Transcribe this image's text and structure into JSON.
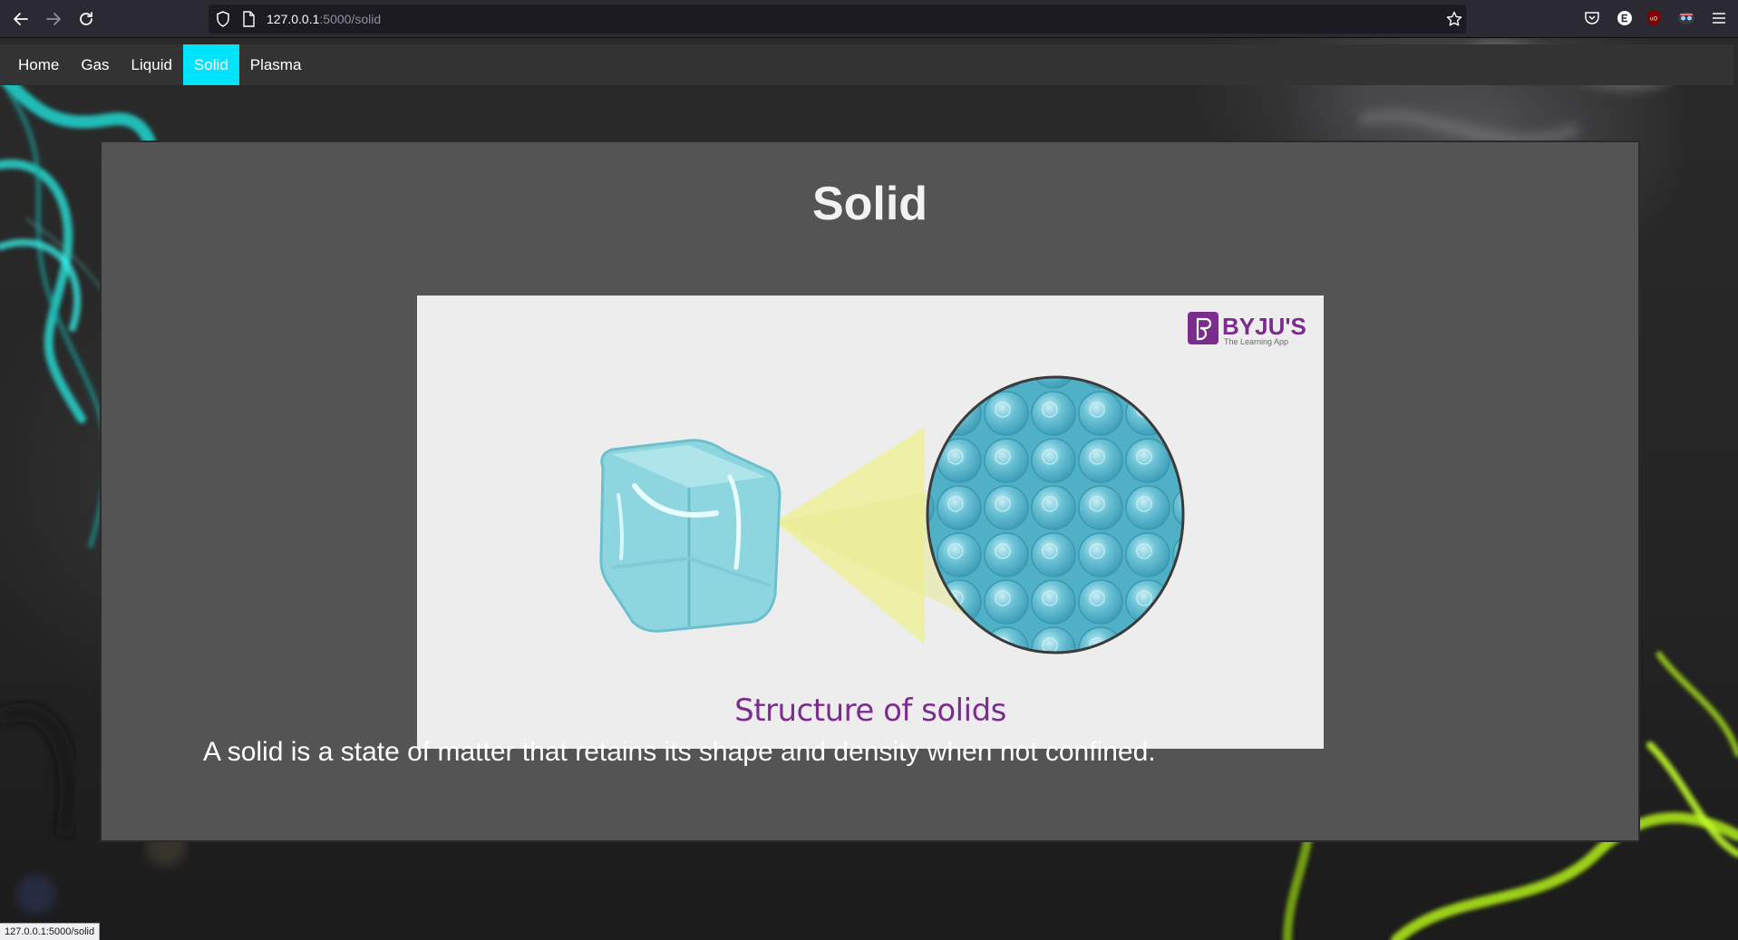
{
  "browser": {
    "url_host": "127.0.0.1",
    "url_path": ":5000/solid",
    "status_url": "127.0.0.1:5000/solid"
  },
  "nav": {
    "items": [
      {
        "label": "Home",
        "active": false
      },
      {
        "label": "Gas",
        "active": false
      },
      {
        "label": "Liquid",
        "active": false
      },
      {
        "label": "Solid",
        "active": true
      },
      {
        "label": "Plasma",
        "active": false
      }
    ]
  },
  "main": {
    "title": "Solid",
    "figure": {
      "caption": "Structure of solids",
      "brand": "BYJU'S",
      "brand_tagline": "The Learning App"
    },
    "description": "A solid is a state of matter that retains its shape and density when not confined."
  },
  "colors": {
    "nav_active": "#00e5ff",
    "nav_bg": "#333333",
    "card_bg": "#545454",
    "caption": "#7b2d8e",
    "brand": "#7b2d8e"
  }
}
